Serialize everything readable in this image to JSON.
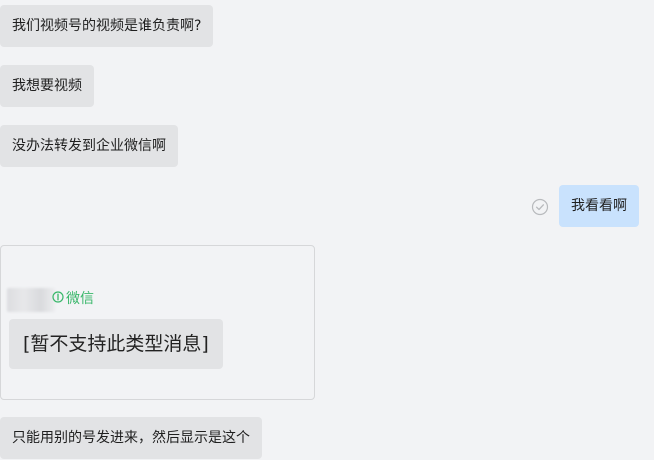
{
  "messages": [
    {
      "id": "m1",
      "side": "left",
      "text": "我们视频号的视频是谁负责啊?"
    },
    {
      "id": "m2",
      "side": "left",
      "text": "我想要视频"
    },
    {
      "id": "m3",
      "side": "left",
      "text": "没办法转发到企业微信啊"
    },
    {
      "id": "m4",
      "side": "right",
      "text": "我看看啊",
      "read_status_icon": "check-circle-icon"
    },
    {
      "id": "m6",
      "side": "left",
      "text": "只能用别的号发进来，然后显示是这个"
    }
  ],
  "card": {
    "brand_label": "微信",
    "unsupported_text": "[暂不支持此类型消息]",
    "brand_color": "#39b76a"
  },
  "colors": {
    "background": "#f2f3f5",
    "incoming_bubble": "#e2e3e5",
    "outgoing_bubble": "#c9e2fd"
  }
}
